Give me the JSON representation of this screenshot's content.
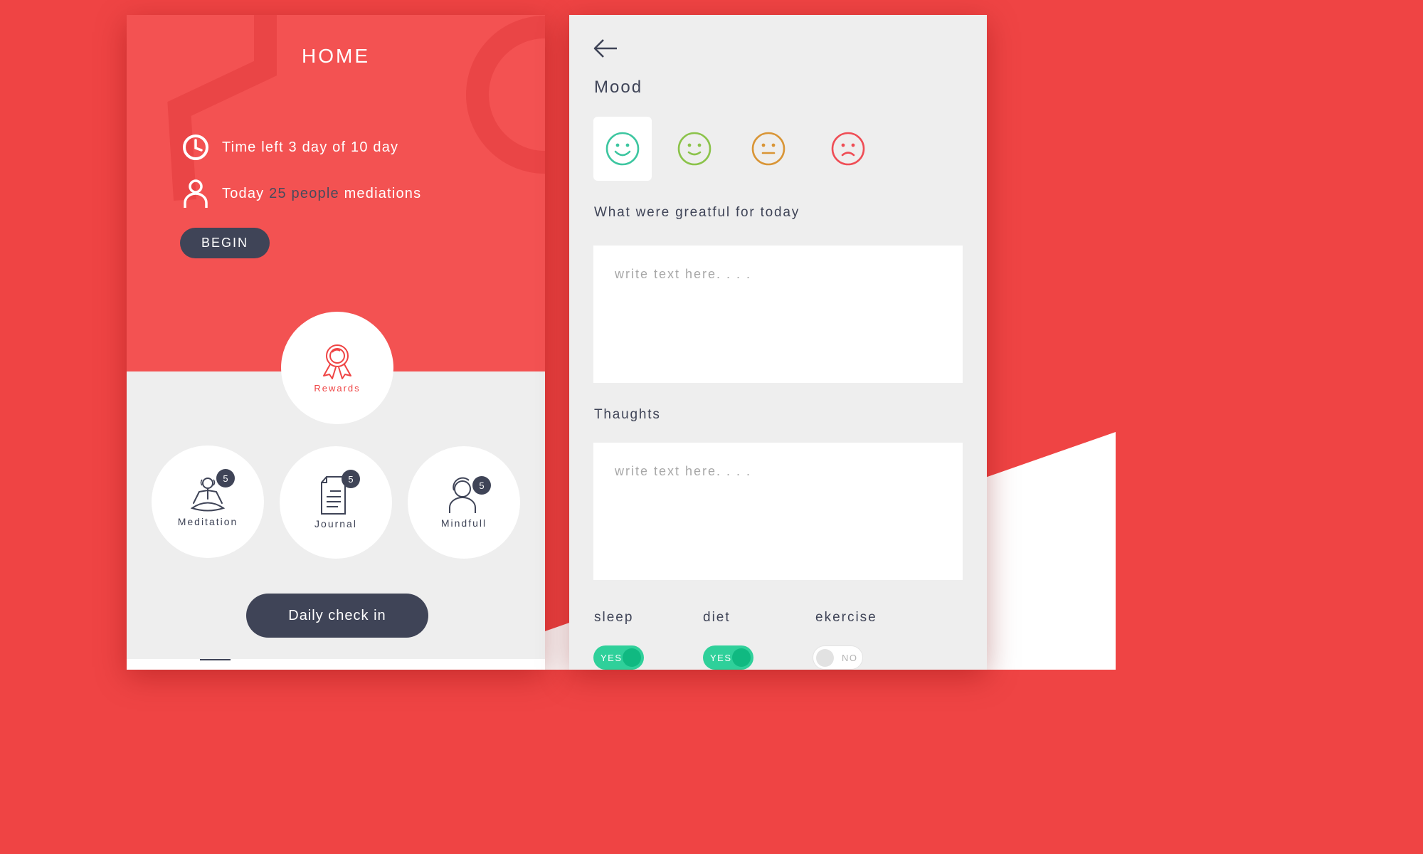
{
  "colors": {
    "primary_red": "#f35252",
    "dark": "#3f4457",
    "green": "#2fd09a"
  },
  "home": {
    "title": "HOME",
    "time_left": {
      "icon": "clock-icon",
      "text": "Time left 3 day of 10 day"
    },
    "people": {
      "icon": "user-icon",
      "prefix": "Today ",
      "count": "25",
      "middle": " people",
      "suffix": " mediations"
    },
    "begin_label": "BEGIN",
    "rewards": {
      "icon": "medal-icon",
      "label": "Rewards"
    },
    "categories": [
      {
        "icon": "meditation-icon",
        "label": "Meditation",
        "badge": "5"
      },
      {
        "icon": "journal-icon",
        "label": "Journal",
        "badge": "5"
      },
      {
        "icon": "mindfull-icon",
        "label": "Mindfull",
        "badge": "5"
      }
    ],
    "checkin_label": "Daily check in"
  },
  "checkin": {
    "back_icon": "arrow-left-icon",
    "mood_title": "Mood",
    "moods": [
      {
        "icon": "very-happy-face-icon",
        "color": "#3dc6a0",
        "selected": true
      },
      {
        "icon": "happy-face-icon",
        "color": "#8bc34a",
        "selected": false
      },
      {
        "icon": "neutral-face-icon",
        "color": "#d99536",
        "selected": false
      },
      {
        "icon": "sad-face-icon",
        "color": "#ef4d55",
        "selected": false
      }
    ],
    "gratitude_label": "What were greatful for today",
    "gratitude_placeholder": "write text here. . . .",
    "thoughts_label": "Thaughts",
    "thoughts_placeholder": "write text here. . . .",
    "toggles": [
      {
        "label": "sleep",
        "state": "YES",
        "on": true
      },
      {
        "label": "diet",
        "state": "YES",
        "on": true
      },
      {
        "label": "ekercise",
        "state": "NO",
        "on": false
      }
    ]
  }
}
